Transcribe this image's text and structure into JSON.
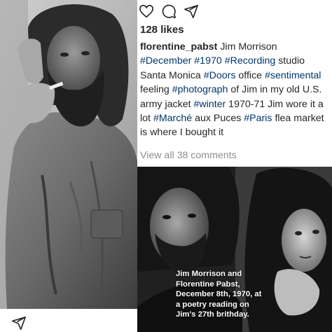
{
  "actions": {
    "like_icon": "heart-icon",
    "comment_icon": "comment-icon",
    "share_icon": "paper-plane-icon"
  },
  "post": {
    "likes": "128 likes",
    "username": "florentine_pabst",
    "caption_parts": [
      {
        "t": " Jim Morrison ",
        "tag": false
      },
      {
        "t": "#December",
        "tag": true
      },
      {
        "t": " ",
        "tag": false
      },
      {
        "t": "#1970",
        "tag": true
      },
      {
        "t": " ",
        "tag": false
      },
      {
        "t": "#Recording",
        "tag": true
      },
      {
        "t": " studio Santa Monica ",
        "tag": false
      },
      {
        "t": "#Doors",
        "tag": true
      },
      {
        "t": " office ",
        "tag": false
      },
      {
        "t": "#sentimental",
        "tag": true
      },
      {
        "t": " feeling  ",
        "tag": false
      },
      {
        "t": "#photograph",
        "tag": true
      },
      {
        "t": " of Jim in  my old U.S. army jacket ",
        "tag": false
      },
      {
        "t": "#winter",
        "tag": true
      },
      {
        "t": " 1970-71 Jim wore it a lot ",
        "tag": false
      },
      {
        "t": "#Marché",
        "tag": true
      },
      {
        "t": " aux Puces ",
        "tag": false
      },
      {
        "t": "#Paris",
        "tag": true
      },
      {
        "t": " flea market is where I bought it",
        "tag": false
      }
    ],
    "comments_link": "View all 38 comments"
  },
  "photo_overlay": {
    "line1": "Jim Morrison and",
    "line2": "Florentine Pabst,",
    "line3": "December 8th, 1970, at",
    "line4": "a poetry reading on",
    "line5": "Jim's 27th brithday."
  },
  "colors": {
    "hashtag": "#00376b",
    "text": "#262626",
    "muted": "#8e8e8e"
  }
}
